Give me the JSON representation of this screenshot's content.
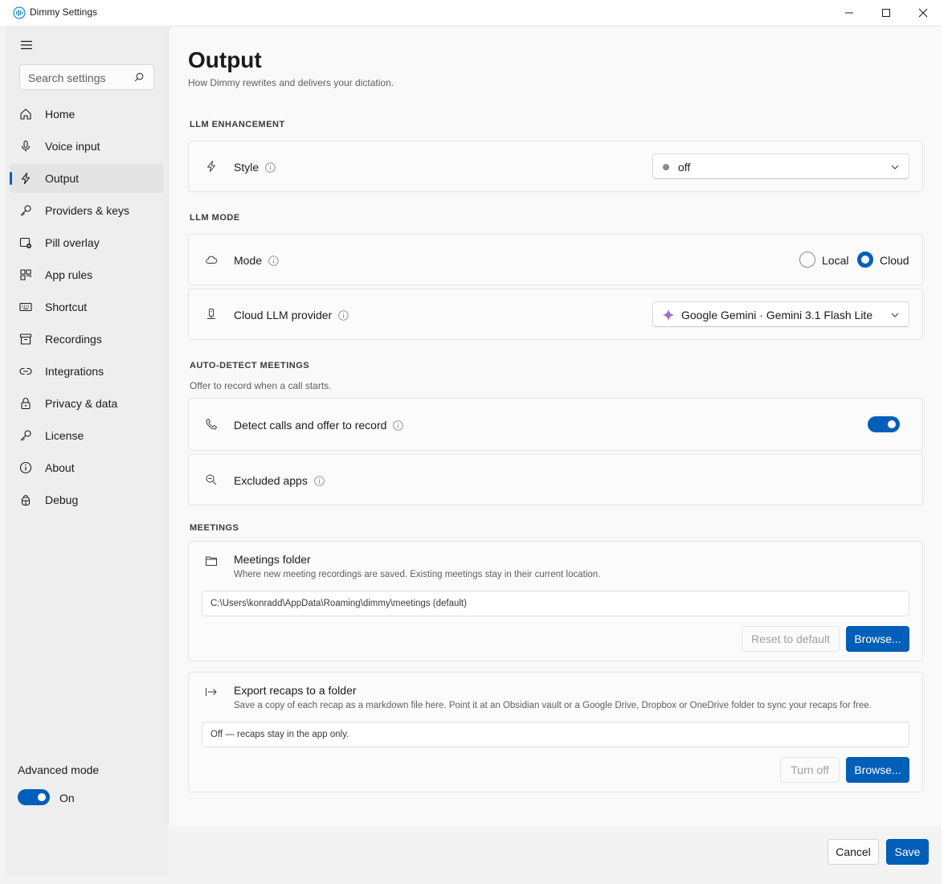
{
  "window": {
    "title": "Dimmy Settings"
  },
  "sidebar": {
    "search_placeholder": "Search settings",
    "items": [
      {
        "label": "Home",
        "icon": "home-icon"
      },
      {
        "label": "Voice input",
        "icon": "microphone-icon"
      },
      {
        "label": "Output",
        "icon": "lightning-icon",
        "active": true
      },
      {
        "label": "Providers & keys",
        "icon": "key-icon"
      },
      {
        "label": "Pill overlay",
        "icon": "overlay-icon"
      },
      {
        "label": "App rules",
        "icon": "app-rules-icon"
      },
      {
        "label": "Shortcut",
        "icon": "keyboard-icon"
      },
      {
        "label": "Recordings",
        "icon": "archive-icon"
      },
      {
        "label": "Integrations",
        "icon": "link-icon"
      },
      {
        "label": "Privacy & data",
        "icon": "lock-icon"
      },
      {
        "label": "License",
        "icon": "key-icon"
      },
      {
        "label": "About",
        "icon": "info-icon"
      },
      {
        "label": "Debug",
        "icon": "bug-icon"
      }
    ],
    "advanced_mode": {
      "label": "Advanced mode",
      "state": "On",
      "enabled": true
    }
  },
  "page": {
    "title": "Output",
    "subtitle": "How Dimmy rewrites and delivers your dictation."
  },
  "llm_enhancement": {
    "heading": "LLM ENHANCEMENT",
    "style": {
      "label": "Style",
      "value": "off"
    }
  },
  "llm_mode": {
    "heading": "LLM MODE",
    "mode": {
      "label": "Mode",
      "options": [
        "Local",
        "Cloud"
      ],
      "selected": "Cloud"
    },
    "provider": {
      "label": "Cloud LLM provider",
      "value": "Google Gemini · Gemini 3.1 Flash Lite"
    }
  },
  "auto_detect": {
    "heading": "AUTO-DETECT MEETINGS",
    "description": "Offer to record when a call starts.",
    "detect_calls": {
      "label": "Detect calls and offer to record",
      "enabled": true
    },
    "excluded_apps": {
      "label": "Excluded apps"
    }
  },
  "meetings": {
    "heading": "MEETINGS",
    "folder": {
      "title": "Meetings folder",
      "description": "Where new meeting recordings are saved. Existing meetings stay in their current location.",
      "path": "C:\\Users\\konradd\\AppData\\Roaming\\dimmy\\meetings  (default)",
      "reset_label": "Reset to default",
      "browse_label": "Browse..."
    },
    "export": {
      "title": "Export recaps to a folder",
      "description": "Save a copy of each recap as a markdown file here. Point it at an Obsidian vault or a Google Drive, Dropbox or OneDrive folder to sync your recaps for free.",
      "path": "Off — recaps stay in the app only.",
      "turn_off_label": "Turn off",
      "browse_label": "Browse..."
    }
  },
  "footer": {
    "cancel_label": "Cancel",
    "save_label": "Save"
  },
  "colors": {
    "accent": "#005fb8",
    "gemini_blue": "#4285f4"
  }
}
